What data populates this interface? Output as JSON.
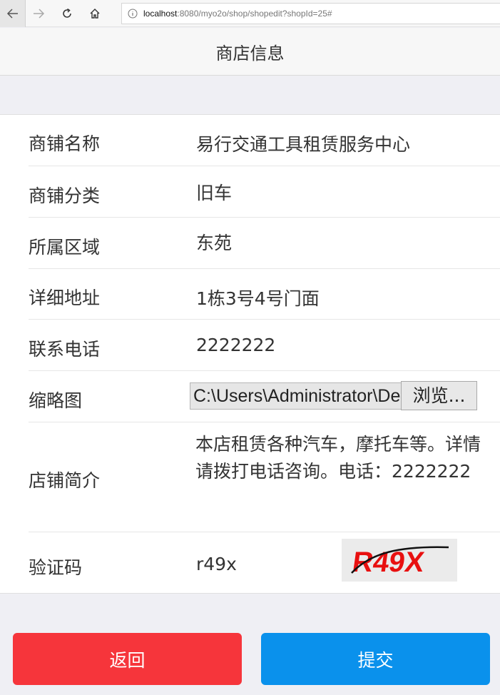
{
  "browser": {
    "url_host": "localhost",
    "url_rest": ":8080/myo2o/shop/shopedit?shopId=25#"
  },
  "header": {
    "title": "商店信息"
  },
  "form": {
    "shop_name": {
      "label": "商铺名称",
      "value": "易行交通工具租赁服务中心"
    },
    "shop_category": {
      "label": "商铺分类",
      "value": "旧车"
    },
    "area": {
      "label": "所属区域",
      "value": "东苑"
    },
    "address": {
      "label": "详细地址",
      "value": "1栋3号4号门面"
    },
    "phone": {
      "label": "联系电话",
      "value": "2222222"
    },
    "thumbnail": {
      "label": "缩略图",
      "file_path": "C:\\Users\\Administrator\\Desktop",
      "browse_label": "浏览..."
    },
    "description": {
      "label": "店铺简介",
      "value": "本店租赁各种汽车，摩托车等。详情请拨打电话咨询。电话：2222222"
    },
    "captcha": {
      "label": "验证码",
      "value": "r49x",
      "image_text": "R49X"
    }
  },
  "buttons": {
    "back_label": "返回",
    "submit_label": "提交"
  },
  "colors": {
    "back_button": "#f6353b",
    "submit_button": "#0a91ec",
    "captcha_text": "#e81010"
  },
  "icons": [
    "back-arrow-icon",
    "forward-arrow-icon",
    "reload-icon",
    "home-icon",
    "info-icon"
  ]
}
